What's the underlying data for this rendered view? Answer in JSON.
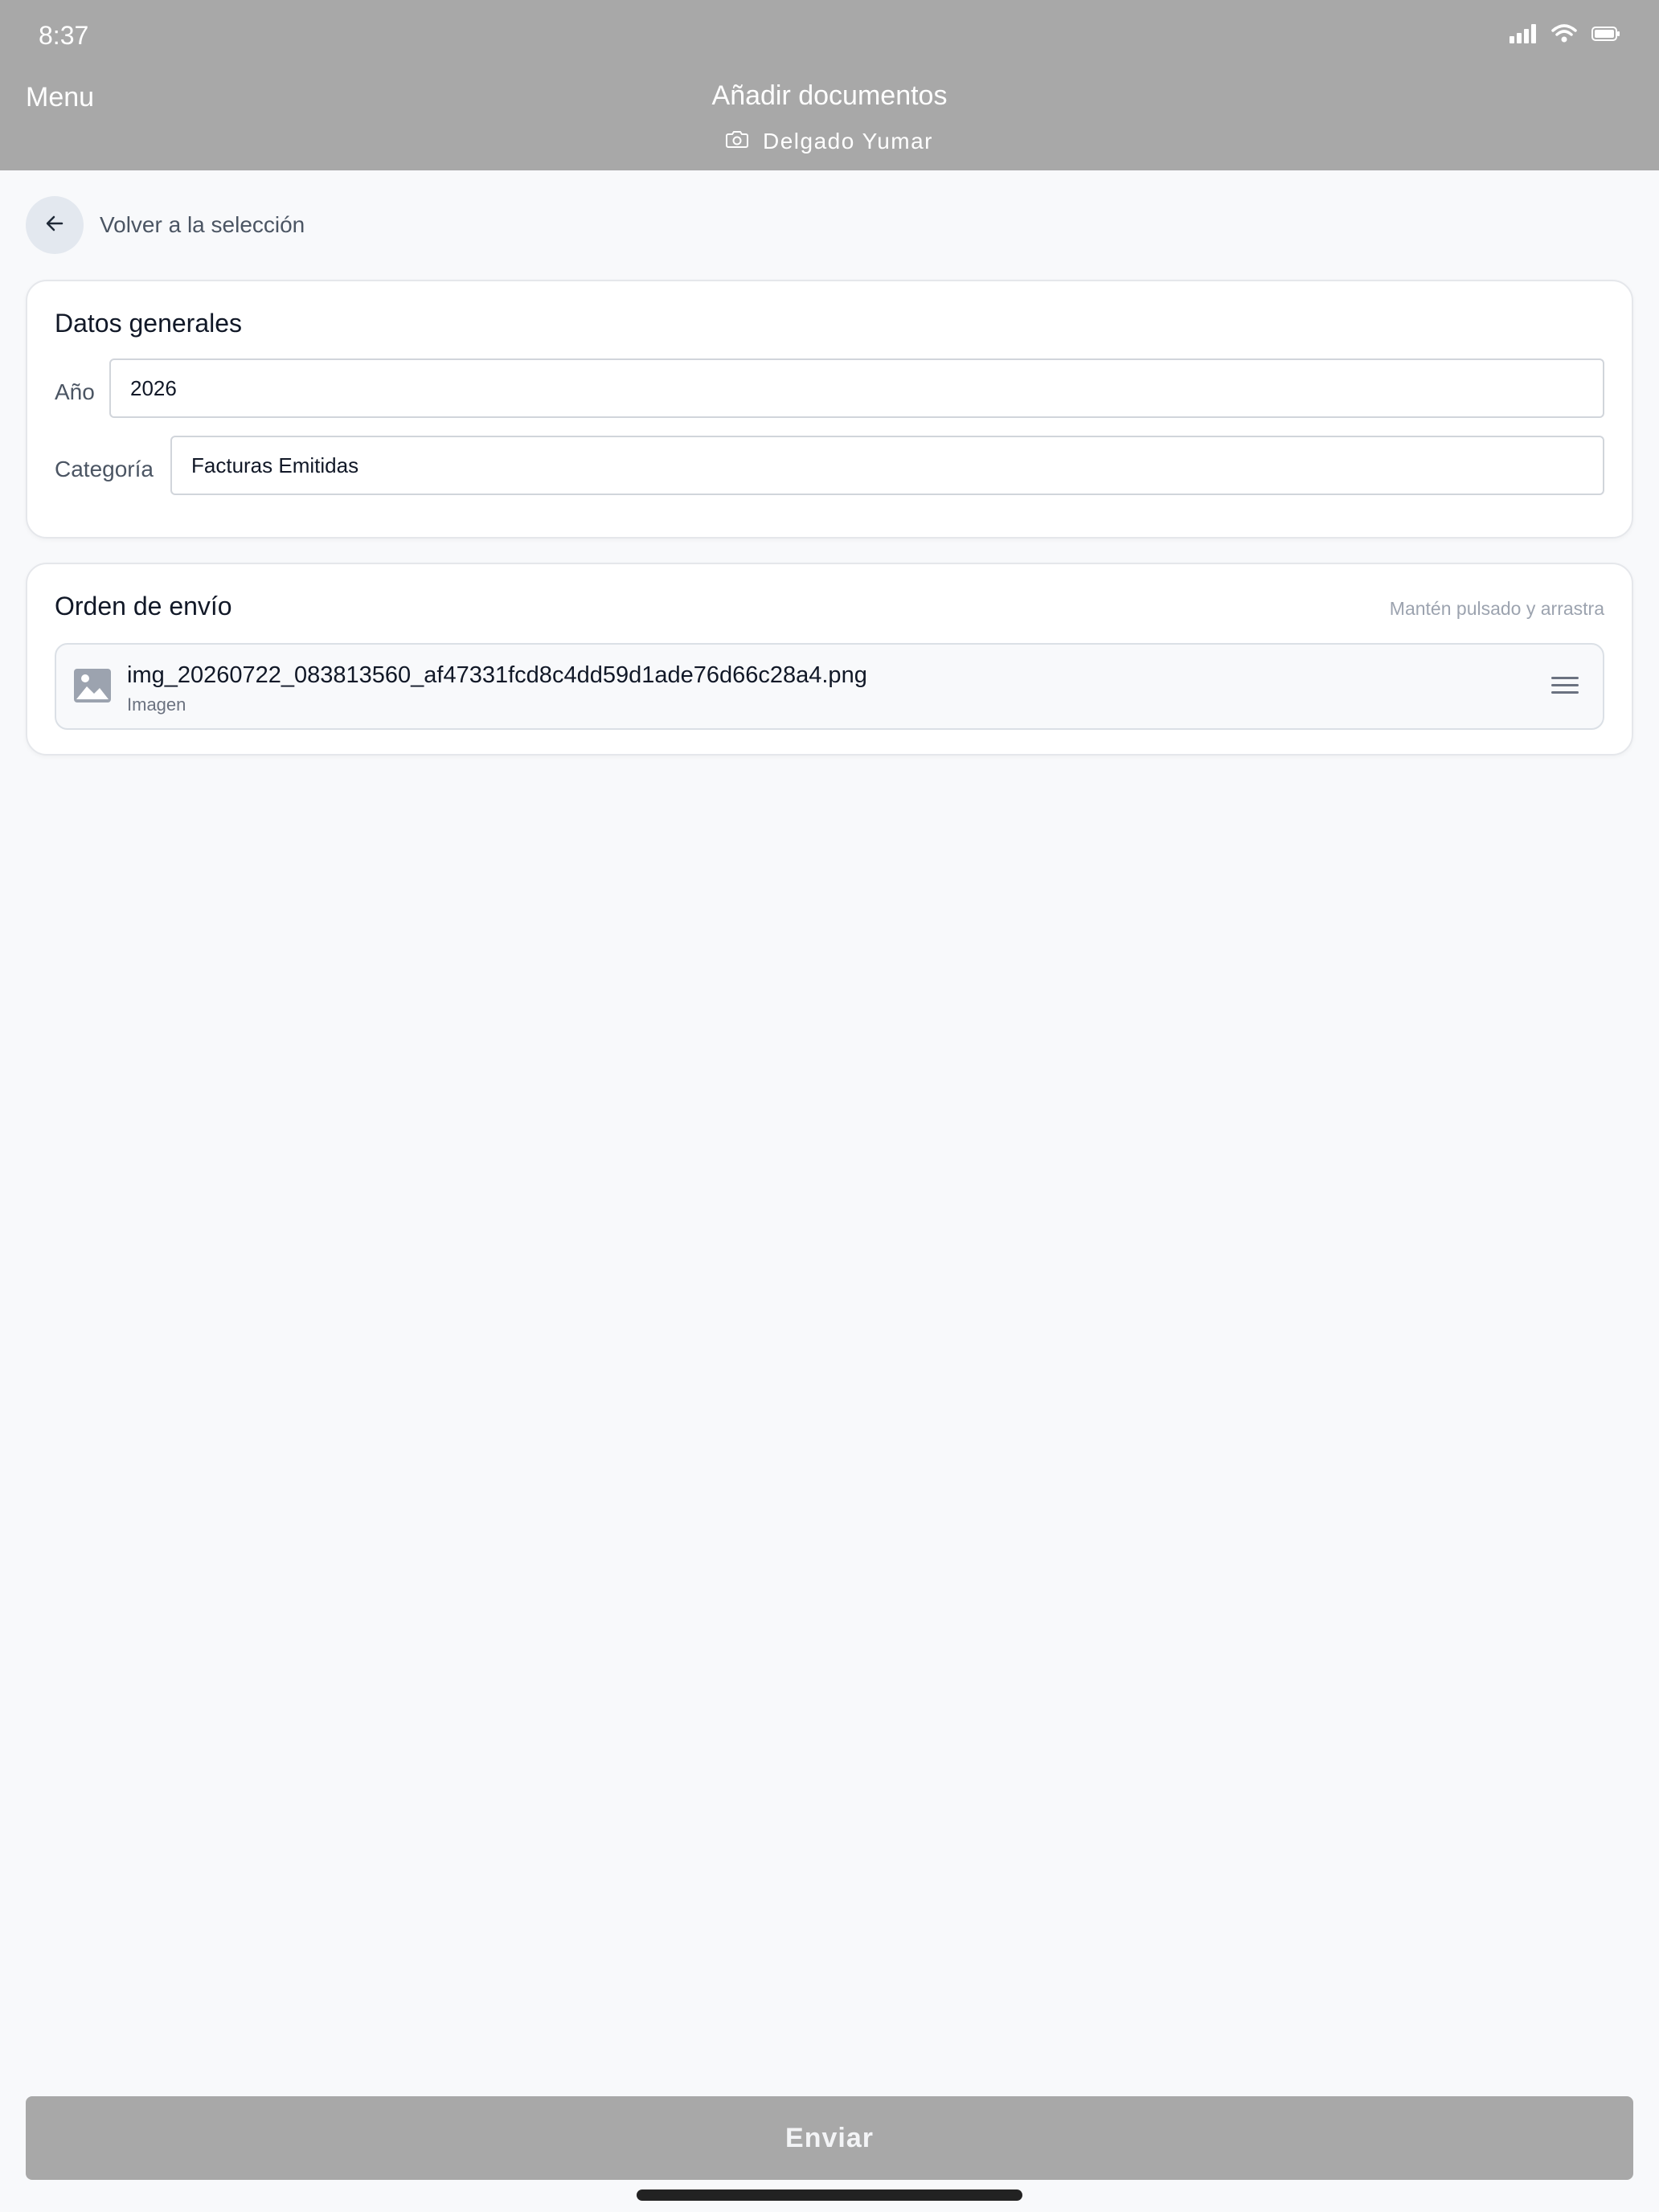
{
  "status_bar": {
    "time": "8:37"
  },
  "header": {
    "menu_label": "Menu",
    "title": "Añadir documentos",
    "subtitle": "Delgado Yumar"
  },
  "back": {
    "label": "Volver a la selección"
  },
  "general": {
    "title": "Datos generales",
    "year_label": "Año",
    "year_value": "2026",
    "category_label": "Categoría",
    "category_value": "Facturas Emitidas"
  },
  "order": {
    "title": "Orden de envío",
    "hint": "Mantén pulsado y arrastra",
    "files": [
      {
        "name": "img_20260722_083813560_af47331fcd8c4dd59d1ade76d66c28a4.png",
        "type": "Imagen"
      }
    ]
  },
  "actions": {
    "send_label": "Enviar"
  },
  "colors": {
    "header_bg": "#a8a8a8",
    "page_bg": "#f8f9fb",
    "button_disabled": "#a8a8a8"
  }
}
